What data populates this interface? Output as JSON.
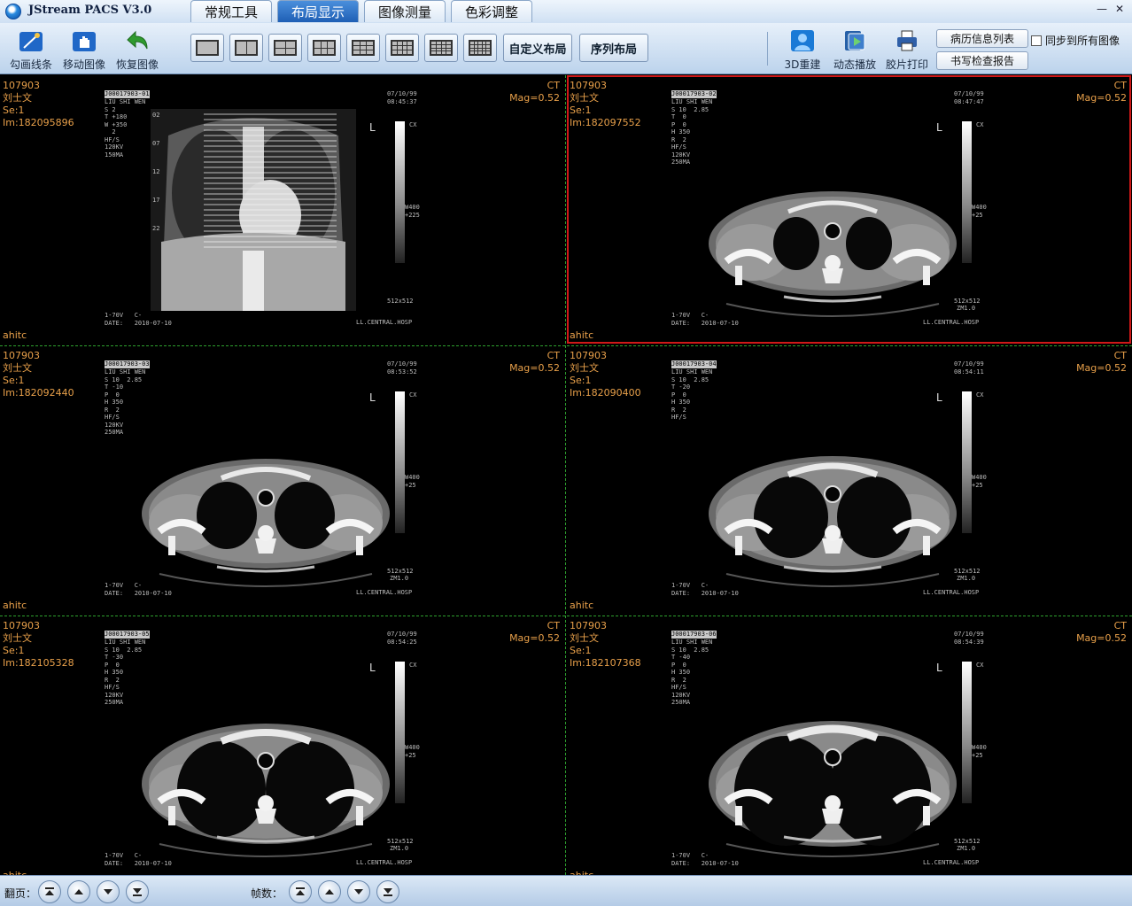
{
  "app": {
    "title": "JStream PACS V3.0"
  },
  "tabs": [
    {
      "label": "常规工具",
      "active": false
    },
    {
      "label": "布局显示",
      "active": true
    },
    {
      "label": "图像测量",
      "active": false
    },
    {
      "label": "色彩调整",
      "active": false
    }
  ],
  "window_controls": {
    "minimize": "—",
    "close": "✕"
  },
  "toolbar": {
    "tools": [
      {
        "label": "勾画线条",
        "icon": "draw-line-icon"
      },
      {
        "label": "移动图像",
        "icon": "hand-move-icon"
      },
      {
        "label": "恢复图像",
        "icon": "undo-arrow-icon"
      }
    ],
    "layouts": [
      {
        "name": "1x1",
        "cols": 1,
        "rows": 1
      },
      {
        "name": "1x2",
        "cols": 1,
        "rows": 2
      },
      {
        "name": "2x2",
        "cols": 2,
        "rows": 2
      },
      {
        "name": "2x3",
        "cols": 2,
        "rows": 3
      },
      {
        "name": "3x3",
        "cols": 3,
        "rows": 3
      },
      {
        "name": "3x4",
        "cols": 3,
        "rows": 4
      },
      {
        "name": "4x4",
        "cols": 4,
        "rows": 4
      },
      {
        "name": "4x5",
        "cols": 4,
        "rows": 5
      }
    ],
    "custom_layout": "自定义布局",
    "series_layout": "序列布局",
    "right_tools": [
      {
        "label": "3D重建",
        "icon": "3d-reconstruction-icon"
      },
      {
        "label": "动态播放",
        "icon": "dynamic-playback-icon"
      },
      {
        "label": "胶片打印",
        "icon": "film-print-icon"
      }
    ],
    "history_button": "病历信息列表",
    "report_button": "书写检查报告",
    "sync_label": "同步到所有图像",
    "sync_checked": false
  },
  "viewports": [
    {
      "patient_id": "107903",
      "patient_name": "刘士文",
      "series": "Se:1",
      "image": "Im:182095896",
      "modality": "CT",
      "mag": "Mag=0.52",
      "station": "ahitc",
      "selected": false,
      "type": "scout",
      "film_id": "J00017903-01",
      "film_text": "LIU SHI WEN\nS 2\nT +180\nW +350\n  2\nHF/S\n120KV\n150MA",
      "film_date": "07/10/99\n08:45:37",
      "kv": "120KV",
      "footer_left": "1-70V   C-\nDATE:   2010-07-10",
      "footer_right": "LL.CENTRAL.HOSP",
      "scale": "512x512",
      "cx": "CX",
      "wl": "W400\n+225",
      "zm": ""
    },
    {
      "patient_id": "107903",
      "patient_name": "刘士文",
      "series": "Se:1",
      "image": "Im:182097552",
      "modality": "CT",
      "mag": "Mag=0.52",
      "station": "ahitc",
      "selected": true,
      "type": "axial",
      "level": 1,
      "film_id": "J00017903-02",
      "film_text": "LIU SHI WEN\nS 10  2.85\nT  0\nP  0\nH 350\nR  2\nHF/S\n120KV\n250MA",
      "film_date": "07/10/99\n08:47:47",
      "kv": "120KV",
      "footer_left": "1-70V   C-\nDATE:   2010-07-10",
      "footer_right": "LL.CENTRAL.HOSP",
      "scale": "512x512",
      "cx": "CX",
      "wl": "W400\n+25",
      "zm": "ZM1.0"
    },
    {
      "patient_id": "107903",
      "patient_name": "刘士文",
      "series": "Se:1",
      "image": "Im:182092440",
      "modality": "CT",
      "mag": "Mag=0.52",
      "station": "ahitc",
      "selected": false,
      "type": "axial",
      "level": 2,
      "film_id": "J00017903-03",
      "film_text": "LIU SHI WEN\nS 10  2.85\nT -10\nP  0\nH 350\nR  2\nHF/S\n120KV\n250MA",
      "film_date": "07/10/99\n08:53:52",
      "kv": "120KV",
      "footer_left": "1-70V   C-\nDATE:   2010-07-10",
      "footer_right": "LL.CENTRAL.HOSP",
      "scale": "512x512",
      "cx": "CX",
      "wl": "W400\n+25",
      "zm": "ZM1.0"
    },
    {
      "patient_id": "107903",
      "patient_name": "刘士文",
      "series": "Se:1",
      "image": "Im:182090400",
      "modality": "CT",
      "mag": "Mag=0.52",
      "station": "ahitc",
      "selected": false,
      "type": "axial",
      "level": 3,
      "film_id": "J00017903-04",
      "film_text": "LIU SHI WEN\nS 10  2.85\nT -20\nP  0\nH 350\nR  2\nHF/S",
      "film_date": "07/10/99\n08:54:11",
      "kv": "",
      "footer_left": "1-70V   C-\nDATE:   2010-07-10",
      "footer_right": "LL.CENTRAL.HOSP",
      "scale": "512x512",
      "cx": "CX",
      "wl": "W400\n+25",
      "zm": "ZM1.0"
    },
    {
      "patient_id": "107903",
      "patient_name": "刘士文",
      "series": "Se:1",
      "image": "Im:182105328",
      "modality": "CT",
      "mag": "Mag=0.52",
      "station": "ahitc",
      "selected": false,
      "type": "axial",
      "level": 4,
      "film_id": "J00017903-05",
      "film_text": "LIU SHI WEN\nS 10  2.85\nT -30\nP  0\nH 350\nR  2\nHF/S\n120KV\n250MA",
      "film_date": "07/10/99\n08:54:25",
      "kv": "120KV",
      "footer_left": "1-70V   C-\nDATE:   2010-07-10",
      "footer_right": "LL.CENTRAL.HOSP",
      "scale": "512x512",
      "cx": "CX",
      "wl": "W400\n+25",
      "zm": "ZM1.0"
    },
    {
      "patient_id": "107903",
      "patient_name": "刘士文",
      "series": "Se:1",
      "image": "Im:182107368",
      "modality": "CT",
      "mag": "Mag=0.52",
      "station": "ahitc",
      "selected": false,
      "type": "axial",
      "level": 5,
      "film_id": "J00017903-06",
      "film_text": "LIU SHI WEN\nS 10  2.85\nT -40\nP  0\nH 350\nR  2\nHF/S\n120KV\n250MA",
      "film_date": "07/10/99\n08:54:39",
      "kv": "120KV",
      "footer_left": "1-70V   C-\nDATE:   2010-07-10",
      "footer_right": "LL.CENTRAL.HOSP",
      "scale": "512x512",
      "cx": "CX",
      "wl": "W400\n+25",
      "zm": "ZM1.0"
    }
  ],
  "scout_lines": [
    "02",
    "07",
    "12",
    "17",
    "22"
  ],
  "bottom": {
    "page_label": "翻页：",
    "frame_label": "帧数：",
    "nav_icons": [
      "first-page-icon",
      "prev-page-icon",
      "next-page-icon",
      "last-page-icon"
    ]
  }
}
